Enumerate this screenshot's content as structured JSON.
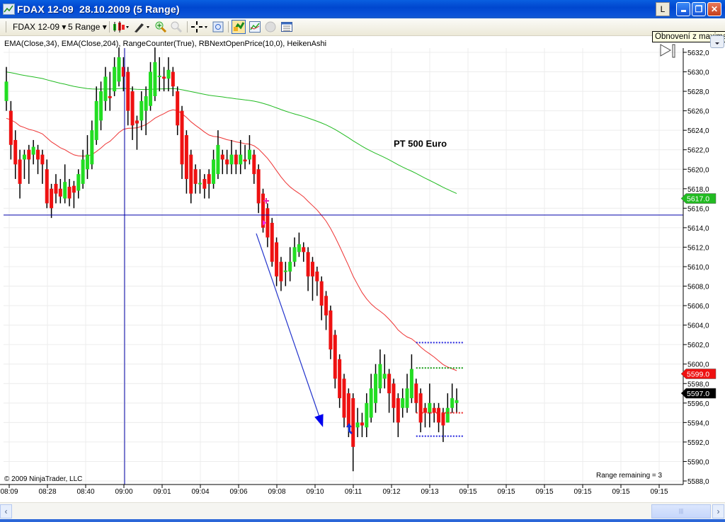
{
  "window": {
    "title": "FDAX 12-09  28.10.2009 (5 Range)",
    "l_button": "L",
    "tooltip": "Obnovení z maximali"
  },
  "toolbar": {
    "instrument": "FDAX 12-09",
    "period": "5 Range",
    "dropdown_arrow": "▾"
  },
  "indicators_label": "EMA(Close,34), EMA(Close,204), RangeCounter(True), RBNextOpenPrice(10,0), HeikenAshi",
  "copyright": "© 2009 NinjaTrader, LLC",
  "range_remaining": "Range remaining = 3",
  "annotation": {
    "text": "PT 500 Euro",
    "bar": 86,
    "price": 5622.3
  },
  "colors": {
    "up": "#22dd22",
    "down": "#ee1111",
    "ema34": "#ee3333",
    "ema204": "#22bb22",
    "crosshair": "#0000aa",
    "rb_high": "#2222dd",
    "rb_mid_green": "#119911",
    "rb_mid_red": "#ee2222"
  },
  "chart_data": {
    "type": "candlestick",
    "price_axis": {
      "min": 5588,
      "max": 5632,
      "step": 2,
      "labels": [
        "5588,0",
        "5590,0",
        "5592,0",
        "5594,0",
        "5596,0",
        "5598,0",
        "5600,0",
        "5602,0",
        "5604,0",
        "5606,0",
        "5608,0",
        "5610,0",
        "5612,0",
        "5614,0",
        "5616,0",
        "5618,0",
        "5620,0",
        "5622,0",
        "5624,0",
        "5626,0",
        "5628,0",
        "5630,0",
        "5632,0"
      ]
    },
    "time_labels": [
      "08:09",
      "08:28",
      "08:40",
      "09:00",
      "09:01",
      "09:04",
      "09:06",
      "09:08",
      "09:10",
      "09:11",
      "09:12",
      "09:13",
      "09:15",
      "09:15",
      "09:15",
      "09:15",
      "09:15",
      "09:15"
    ],
    "price_badges": [
      {
        "label": "5617.0",
        "price": 5617.0,
        "color": "#22bb22"
      },
      {
        "label": "5599.0",
        "price": 5599.0,
        "color": "#ee1111"
      },
      {
        "label": "5597.0",
        "price": 5597.0,
        "color": "#000000"
      }
    ],
    "crosshair": {
      "price": 5615.3,
      "bar": 26
    },
    "ema_seeds": {
      "ema34": 5625.0,
      "ema204": 5630.0
    },
    "rb_levels": [
      {
        "price": 5602.2,
        "color": "#2222dd",
        "from_bar": 91,
        "to_bar": 101
      },
      {
        "price": 5599.6,
        "color": "#119911",
        "from_bar": 91,
        "to_bar": 101
      },
      {
        "price": 5595.0,
        "color": "#ee2222",
        "from_bar": 91,
        "to_bar": 101
      },
      {
        "price": 5592.6,
        "color": "#2222dd",
        "from_bar": 91,
        "to_bar": 101
      }
    ],
    "trend_arrow": {
      "from_bar": 55.5,
      "from_price": 5613.4,
      "to_bar": 70.1,
      "to_price": 5593.8
    },
    "candles_ochl": [
      [
        5627,
        5629,
        5630.5,
        5626
      ],
      [
        5626,
        5622.5,
        5627,
        5621
      ],
      [
        5623,
        5620.5,
        5624,
        5619
      ],
      [
        5621,
        5618.5,
        5622,
        5617
      ],
      [
        5621,
        5621.5,
        5622,
        5619
      ],
      [
        5622,
        5621,
        5622.5,
        5618.5
      ],
      [
        5621.5,
        5622.3,
        5623,
        5620.5
      ],
      [
        5622,
        5621,
        5622.5,
        5619.5
      ],
      [
        5621.5,
        5620.5,
        5622,
        5618.5
      ],
      [
        5620,
        5616.5,
        5621,
        5616
      ],
      [
        5618,
        5616,
        5618.5,
        5615
      ],
      [
        5618.5,
        5617.5,
        5619.5,
        5616.5
      ],
      [
        5618,
        5617.2,
        5619,
        5616.5
      ],
      [
        5617,
        5618.7,
        5620.5,
        5616.5
      ],
      [
        5618.2,
        5617,
        5619,
        5616.2
      ],
      [
        5618.3,
        5617.6,
        5618.8,
        5616
      ],
      [
        5617.8,
        5619.5,
        5620,
        5617
      ],
      [
        5618.5,
        5621,
        5622,
        5618
      ],
      [
        5620,
        5621.5,
        5623.5,
        5619
      ],
      [
        5620.5,
        5624,
        5625,
        5620
      ],
      [
        5623,
        5627,
        5628.5,
        5622.5
      ],
      [
        5625,
        5628,
        5629,
        5624
      ],
      [
        5627,
        5629.5,
        5630.5,
        5626
      ],
      [
        5627.5,
        5627.3,
        5630,
        5626
      ],
      [
        5628,
        5630.5,
        5631.5,
        5627.5
      ],
      [
        5629,
        5631.5,
        5632.5,
        5628.5
      ],
      [
        5630.5,
        5629.5,
        5631.5,
        5628
      ],
      [
        5630,
        5626,
        5630.5,
        5624.5
      ],
      [
        5628,
        5624.5,
        5628.5,
        5623
      ],
      [
        5625,
        5624.7,
        5625.5,
        5622
      ],
      [
        5625,
        5627,
        5628,
        5624
      ],
      [
        5626,
        5627.5,
        5628.5,
        5623.5
      ],
      [
        5626.5,
        5630,
        5631,
        5626
      ],
      [
        5627.5,
        5631,
        5632.5,
        5627
      ],
      [
        5629.5,
        5629.6,
        5631.5,
        5628
      ],
      [
        5629.5,
        5629.3,
        5630.5,
        5628
      ],
      [
        5629.3,
        5630.2,
        5631.5,
        5628
      ],
      [
        5630,
        5628.5,
        5630.5,
        5627.5
      ],
      [
        5628,
        5624.5,
        5628.5,
        5623.5
      ],
      [
        5626,
        5620.5,
        5626.5,
        5619
      ],
      [
        5623.5,
        5619,
        5624,
        5617.5
      ],
      [
        5621.5,
        5617.5,
        5622,
        5616.5
      ],
      [
        5620,
        5618.5,
        5620.5,
        5617.5
      ],
      [
        5618.5,
        5618.6,
        5620,
        5617.5
      ],
      [
        5619,
        5618,
        5619.5,
        5617
      ],
      [
        5619.5,
        5618.5,
        5620,
        5617
      ],
      [
        5618.5,
        5621,
        5622,
        5618
      ],
      [
        5619.5,
        5622.5,
        5624,
        5619
      ],
      [
        5621.5,
        5621,
        5622,
        5619.5
      ],
      [
        5621,
        5620.5,
        5622,
        5619.5
      ],
      [
        5620.5,
        5621.5,
        5623,
        5619.5
      ],
      [
        5621.5,
        5620.5,
        5622,
        5619.5
      ],
      [
        5620.5,
        5621.5,
        5623,
        5619.5
      ],
      [
        5621,
        5620.8,
        5622.5,
        5620
      ],
      [
        5621,
        5622,
        5623.5,
        5620.5
      ],
      [
        5621.5,
        5619.5,
        5622,
        5618.5
      ],
      [
        5620,
        5616.5,
        5620.5,
        5615.5
      ],
      [
        5617.5,
        5614,
        5618,
        5613.5
      ],
      [
        5616,
        5613,
        5616.5,
        5612
      ],
      [
        5614.5,
        5610.5,
        5615,
        5610
      ],
      [
        5612.5,
        5609,
        5613,
        5608
      ],
      [
        5610.5,
        5608.5,
        5611,
        5607.5
      ],
      [
        5609.5,
        5609.6,
        5610.5,
        5608
      ],
      [
        5609.5,
        5610.5,
        5612,
        5608.5
      ],
      [
        5610.5,
        5612,
        5613,
        5610
      ],
      [
        5611.5,
        5612.3,
        5613.5,
        5611
      ],
      [
        5612,
        5611.5,
        5612.5,
        5610.5
      ],
      [
        5611.5,
        5609,
        5612,
        5607.5
      ],
      [
        5610.5,
        5609,
        5611,
        5606.5
      ],
      [
        5609.5,
        5608.5,
        5610,
        5607
      ],
      [
        5608.5,
        5606,
        5609,
        5604.5
      ],
      [
        5607,
        5605,
        5607.5,
        5603.5
      ],
      [
        5605.5,
        5601.5,
        5606,
        5600.5
      ],
      [
        5603,
        5598.5,
        5603.5,
        5597.5
      ],
      [
        5600.5,
        5596.5,
        5601,
        5595.5
      ],
      [
        5598.5,
        5594.5,
        5599,
        5593.5
      ],
      [
        5597,
        5593.5,
        5597.5,
        5592.5
      ],
      [
        5596.5,
        5591.5,
        5597,
        5589
      ],
      [
        5593.5,
        5594,
        5595.5,
        5592.5
      ],
      [
        5594,
        5593.7,
        5595,
        5592.5
      ],
      [
        5593.5,
        5596,
        5597,
        5592.5
      ],
      [
        5594.5,
        5597.5,
        5599,
        5594
      ],
      [
        5596,
        5599,
        5600,
        5595
      ],
      [
        5597.5,
        5600,
        5601.5,
        5597
      ],
      [
        5598.5,
        5599,
        5601,
        5597.5
      ],
      [
        5599,
        5597,
        5599.5,
        5595
      ],
      [
        5598,
        5595.5,
        5598.5,
        5594
      ],
      [
        5596.5,
        5594,
        5597,
        5592.5
      ],
      [
        5595.5,
        5596.5,
        5597.5,
        5594.5
      ],
      [
        5595.5,
        5597.5,
        5599,
        5595
      ],
      [
        5596.5,
        5599.5,
        5601,
        5596
      ],
      [
        5598,
        5596,
        5598.5,
        5595
      ],
      [
        5597,
        5594,
        5597.5,
        5593
      ],
      [
        5595.5,
        5595,
        5596,
        5593.5
      ],
      [
        5595,
        5596,
        5598,
        5593.5
      ],
      [
        5595.5,
        5595,
        5596,
        5594
      ],
      [
        5595.5,
        5594,
        5596,
        5593
      ],
      [
        5595,
        5593.7,
        5595.5,
        5592
      ],
      [
        5594,
        5595.5,
        5597,
        5594
      ],
      [
        5595.5,
        5596.5,
        5598,
        5595
      ],
      [
        5596,
        5596.3,
        5597.5,
        5595
      ]
    ]
  }
}
